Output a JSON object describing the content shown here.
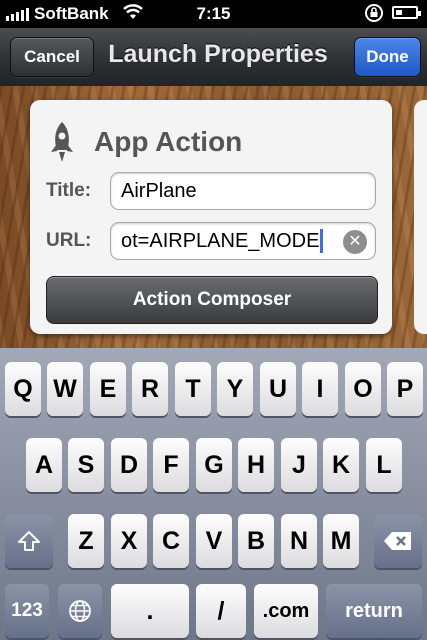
{
  "status": {
    "carrier": "SoftBank",
    "time": "7:15"
  },
  "nav": {
    "cancel": "Cancel",
    "title": "Launch Properties",
    "done": "Done"
  },
  "card": {
    "heading": "App Action",
    "title_label": "Title:",
    "title_value": "AirPlane",
    "url_label": "URL:",
    "url_value": "ot=AIRPLANE_MODE",
    "composer": "Action Composer"
  },
  "keyboard": {
    "row1": [
      "Q",
      "W",
      "E",
      "R",
      "T",
      "Y",
      "U",
      "I",
      "O",
      "P"
    ],
    "row2": [
      "A",
      "S",
      "D",
      "F",
      "G",
      "H",
      "J",
      "K",
      "L"
    ],
    "row3": [
      "Z",
      "X",
      "C",
      "V",
      "B",
      "N",
      "M"
    ],
    "k123": "123",
    "dot": ".",
    "slash": "/",
    "dotcom": ".com",
    "return": "return"
  }
}
